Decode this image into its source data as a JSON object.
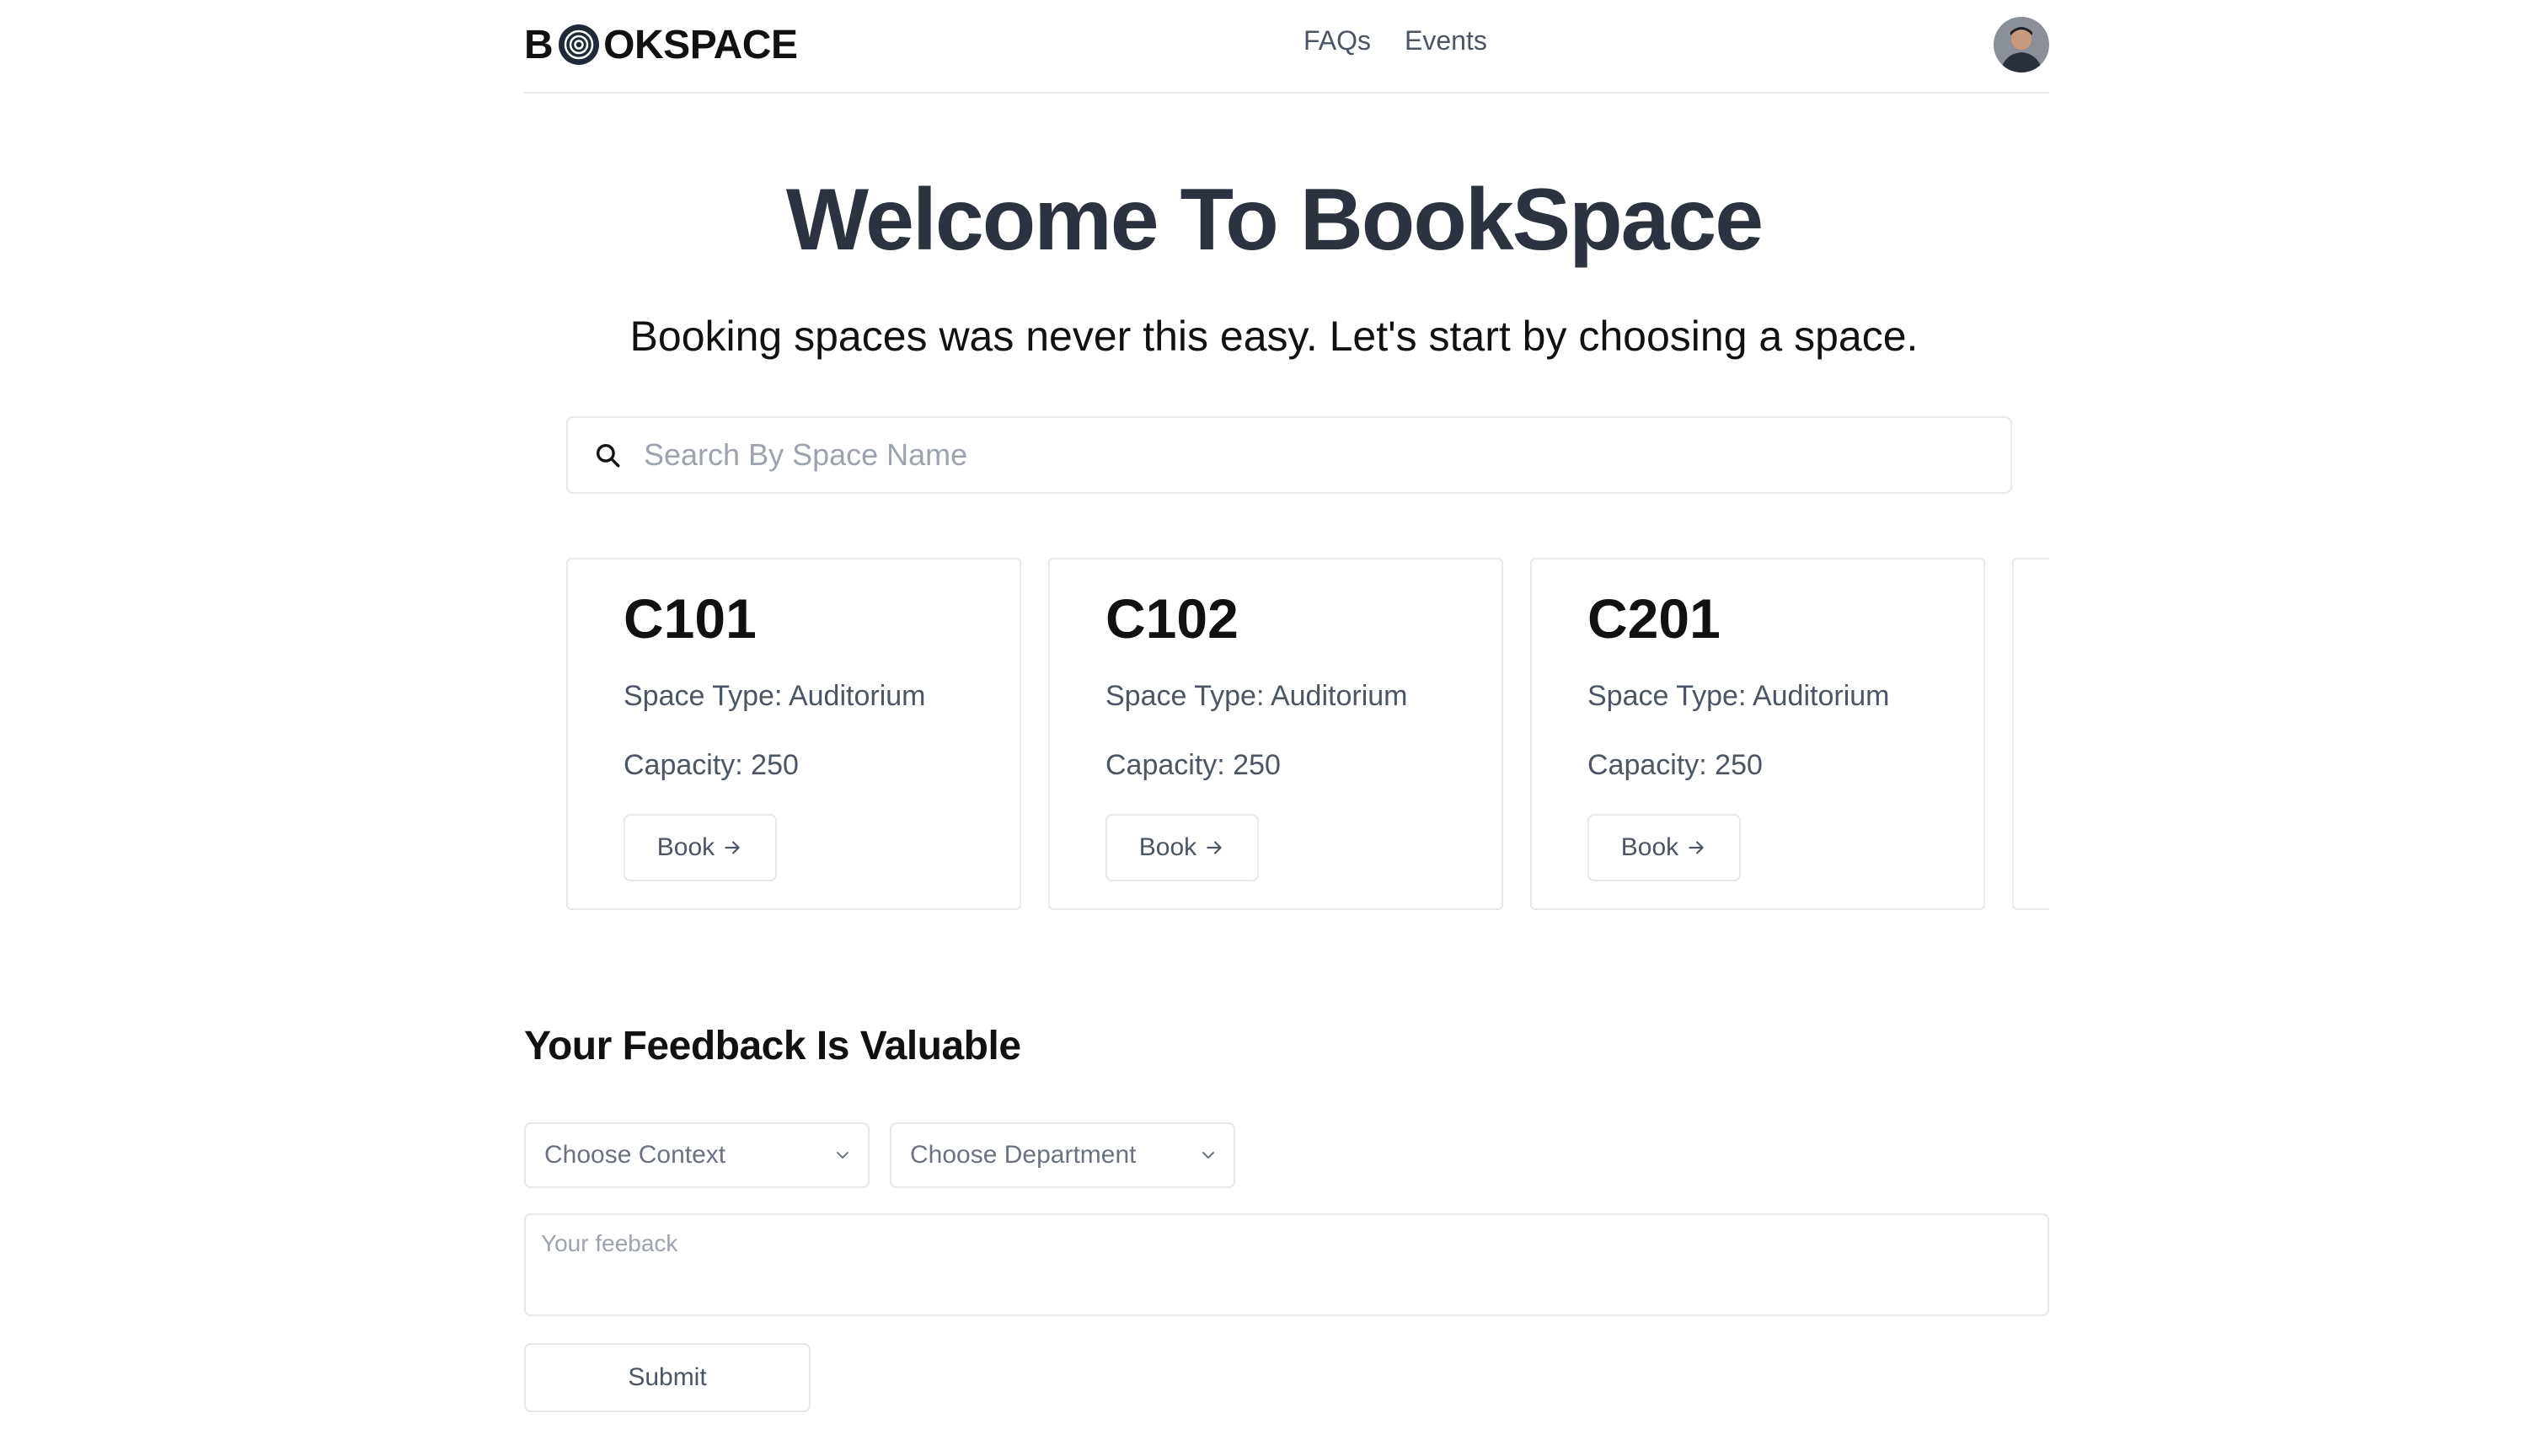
{
  "header": {
    "logo": {
      "prefix": "B",
      "suffix": "OKSPACE",
      "mark_icon": "spiral-o-icon"
    },
    "nav": [
      {
        "label": "FAQs"
      },
      {
        "label": "Events"
      }
    ],
    "avatar_icon": "user-avatar"
  },
  "hero": {
    "title": "Welcome To BookSpace",
    "subtitle": "Booking spaces was never this easy. Let's start by choosing a space."
  },
  "search": {
    "placeholder": "Search By Space Name",
    "value": "",
    "icon": "search-icon"
  },
  "spaces": [
    {
      "name": "C101",
      "type": "Space Type: Auditorium",
      "capacity": "Capacity: 250",
      "book_label": "Book",
      "book_icon": "arrow-right-icon"
    },
    {
      "name": "C102",
      "type": "Space Type: Auditorium",
      "capacity": "Capacity: 250",
      "book_label": "Book",
      "book_icon": "arrow-right-icon"
    },
    {
      "name": "C201",
      "type": "Space Type: Auditorium",
      "capacity": "Capacity: 250",
      "book_label": "Book",
      "book_icon": "arrow-right-icon"
    }
  ],
  "feedback": {
    "title": "Your Feedback Is Valuable",
    "context_select": {
      "selected": "Choose Context",
      "icon": "chevron-down-icon"
    },
    "department_select": {
      "selected": "Choose Department",
      "icon": "chevron-down-icon"
    },
    "textarea": {
      "placeholder": "Your feeback",
      "value": ""
    },
    "submit_label": "Submit"
  },
  "colors": {
    "title": "#2d3240",
    "border": "#e5e7eb",
    "muted_text": "#4b5563",
    "placeholder": "#9ca3af"
  }
}
